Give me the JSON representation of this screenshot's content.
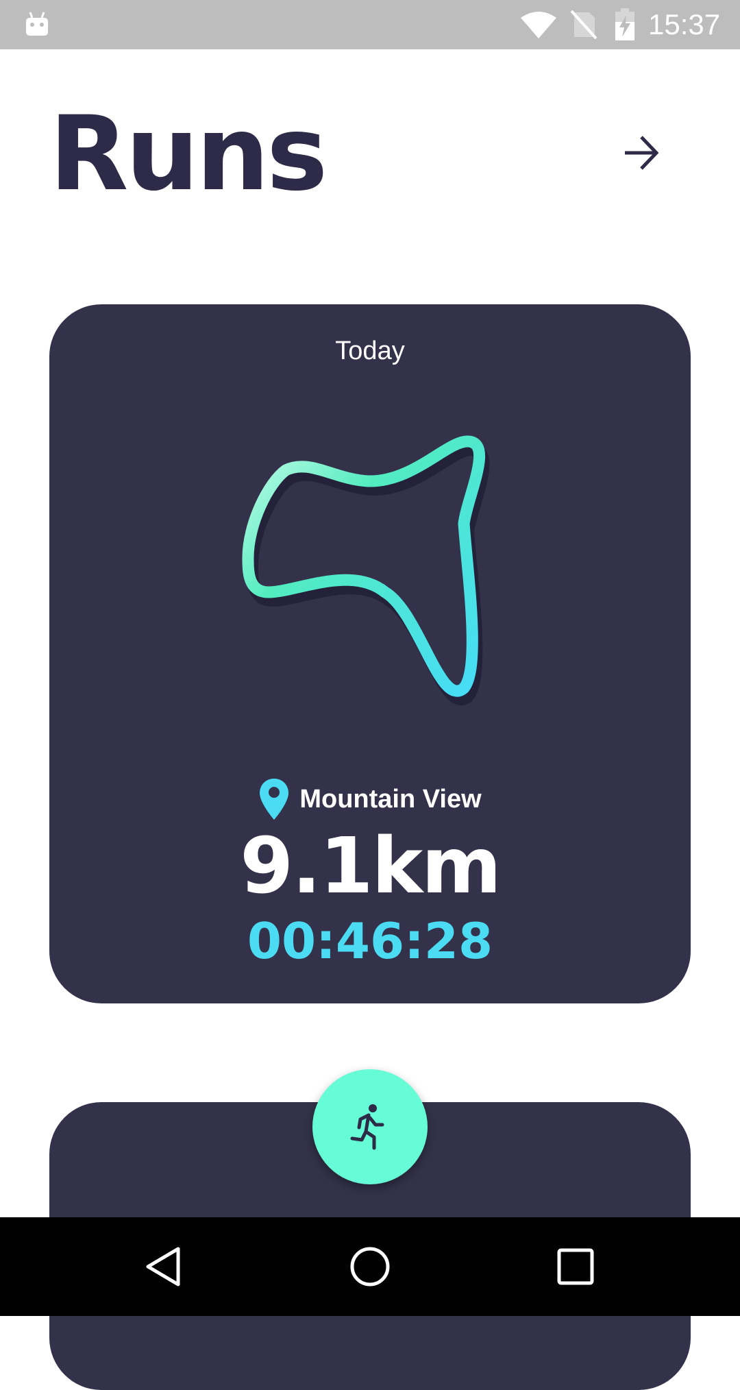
{
  "status_bar": {
    "time": "15:37",
    "icons": [
      "android-icon",
      "wifi-icon",
      "no-sim-icon",
      "battery-charging-icon"
    ]
  },
  "header": {
    "title": "Runs",
    "next_icon": "arrow-right-icon"
  },
  "run_card": {
    "date": "Today",
    "location": "Mountain View",
    "distance": "9.1km",
    "duration": "00:46:28",
    "route_colors": {
      "start": "#c8fce8",
      "mid": "#52ecc0",
      "end": "#46dcf8"
    }
  },
  "fab": {
    "icon": "run-icon",
    "color": "#66fcd6"
  },
  "nav_bar": {
    "icons": [
      "back-icon",
      "home-icon",
      "recents-icon"
    ]
  },
  "colors": {
    "title": "#2e2b48",
    "card": "#34324a",
    "accent": "#4bdcf4"
  }
}
